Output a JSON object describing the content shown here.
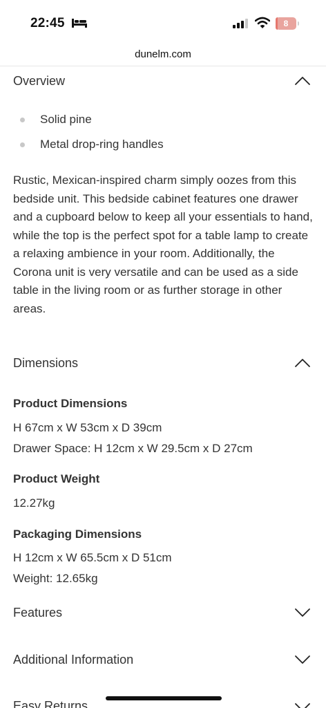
{
  "status_bar": {
    "time": "22:45",
    "battery_level": "8",
    "battery_percent": 8
  },
  "browser": {
    "url": "dunelm.com"
  },
  "overview": {
    "title": "Overview",
    "bullets": [
      "Solid pine",
      "Metal drop-ring handles"
    ],
    "description": "Rustic, Mexican-inspired charm simply oozes from this bedside unit. This bedside cabinet features one drawer and a cupboard below to keep all your essentials to hand, while the top is the perfect spot for a table lamp to create a relaxing ambience in your room. Additionally, the Corona unit is very versatile and can be used as a side table in the living room or as further storage in other areas."
  },
  "dimensions": {
    "title": "Dimensions",
    "product_dimensions_heading": "Product Dimensions",
    "product_dimensions_line1": "H 67cm x W 53cm x D 39cm",
    "product_dimensions_line2": "Drawer Space: H 12cm x W 29.5cm x D 27cm",
    "product_weight_heading": "Product Weight",
    "product_weight_value": "12.27kg",
    "packaging_heading": "Packaging Dimensions",
    "packaging_line1": "H 12cm x W 65.5cm x D 51cm",
    "packaging_line2": "Weight: 12.65kg"
  },
  "features": {
    "title": "Features"
  },
  "additional_info": {
    "title": "Additional Information"
  },
  "easy_returns": {
    "title": "Easy Returns"
  },
  "colors": {
    "text": "#333333",
    "battery": "#e5776d"
  }
}
